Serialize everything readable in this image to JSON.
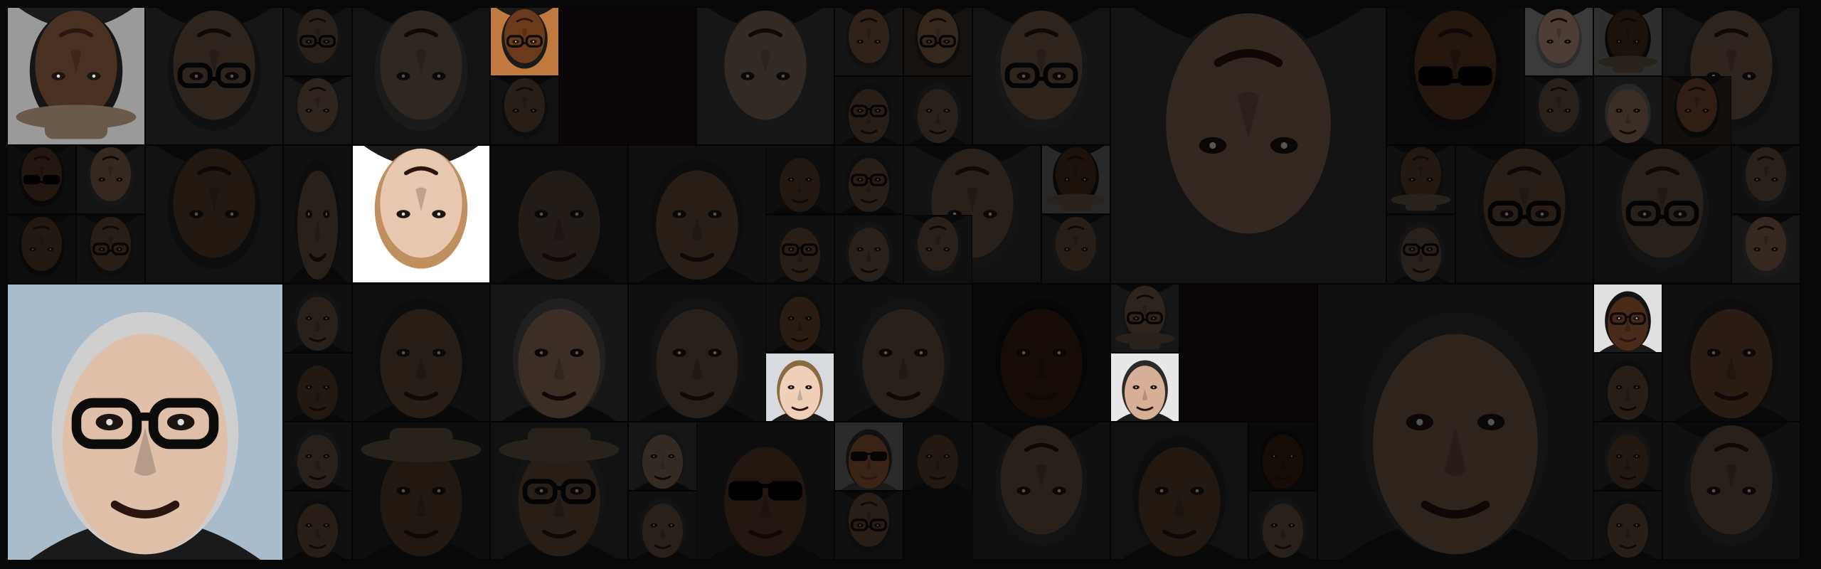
{
  "page": {
    "background": "#080808"
  },
  "mosaic": {
    "tiles": [
      {
        "kind": "photo",
        "state": "bright",
        "skin": "#4a3020",
        "bg": "#9a9a9a",
        "hair": "#151515",
        "glasses": false,
        "shades": false,
        "flip": true,
        "hat": true
      },
      {
        "kind": "photo",
        "state": "dim",
        "skin": "#7a6050",
        "bg": "#3a3a3a",
        "hair": "#2a2a2a",
        "glasses": true,
        "shades": false,
        "flip": true,
        "hat": false
      },
      {
        "kind": "photo",
        "state": "dim",
        "skin": "#6a5848",
        "bg": "#303030",
        "hair": "#333333",
        "glasses": true,
        "shades": false,
        "flip": true,
        "hat": false
      },
      {
        "kind": "photo",
        "state": "dim",
        "skin": "#7a6858",
        "bg": "#333333",
        "hair": "#444444",
        "glasses": false,
        "shades": false,
        "flip": true,
        "hat": false
      },
      {
        "kind": "photo",
        "state": "bright",
        "skin": "#6a3a1a",
        "bg": "#c07a40",
        "hair": "#1a1a1a",
        "glasses": true,
        "shades": false,
        "flip": true,
        "hat": false
      },
      {
        "kind": "photo",
        "state": "dim",
        "skin": "#6a5040",
        "bg": "#2d2d2d",
        "hair": "#222222",
        "glasses": false,
        "shades": false,
        "flip": true,
        "hat": false
      },
      {
        "kind": "blank",
        "state": "dim",
        "bg": "#1c1214"
      },
      {
        "kind": "photo",
        "state": "dim",
        "skin": "#857060",
        "bg": "#3b3b3b",
        "hair": "#3a3a3a",
        "glasses": false,
        "shades": false,
        "flip": true,
        "hat": false
      },
      {
        "kind": "photo",
        "state": "dim",
        "skin": "#7a5a48",
        "bg": "#353535",
        "hair": "#2a2a2a",
        "glasses": false,
        "shades": false,
        "flip": true,
        "hat": false
      },
      {
        "kind": "photo",
        "state": "dim",
        "skin": "#8a6a50",
        "bg": "#3a3028",
        "hair": "#222222",
        "glasses": true,
        "shades": false,
        "flip": true,
        "hat": false
      },
      {
        "kind": "photo",
        "state": "dim",
        "skin": "#7a6050",
        "bg": "#333333",
        "hair": "#3a3a3a",
        "glasses": true,
        "shades": false,
        "flip": true,
        "hat": false
      },
      {
        "kind": "photo",
        "state": "dim",
        "skin": "#856a58",
        "bg": "#363636",
        "hair": "#333333",
        "glasses": false,
        "shades": false,
        "flip": true,
        "hat": false
      },
      {
        "kind": "photo",
        "state": "dim",
        "skin": "#5a3a28",
        "bg": "#1e1e1e",
        "hair": "#151515",
        "glasses": false,
        "shades": true,
        "flip": true,
        "hat": false
      },
      {
        "kind": "photo",
        "state": "dim",
        "skin": "#c8a090",
        "bg": "#9a9a9a",
        "hair": "#777777",
        "glasses": false,
        "shades": false,
        "flip": true,
        "hat": false
      },
      {
        "kind": "photo",
        "state": "dim",
        "skin": "#4a3020",
        "bg": "#7a7a7a",
        "hair": "#151515",
        "glasses": false,
        "shades": false,
        "flip": true,
        "hat": true
      },
      {
        "kind": "photo",
        "state": "dim",
        "skin": "#7a6050",
        "bg": "#333333",
        "hair": "#2a2a2a",
        "glasses": false,
        "shades": false,
        "flip": true,
        "hat": false
      },
      {
        "kind": "photo",
        "state": "dim",
        "skin": "#5a3a2a",
        "bg": "#262626",
        "hair": "#1a1a1a",
        "glasses": false,
        "shades": true,
        "flip": true,
        "hat": false
      },
      {
        "kind": "photo",
        "state": "dim",
        "skin": "#8a6a58",
        "bg": "#333333",
        "hair": "#3a3a3a",
        "glasses": false,
        "shades": false,
        "flip": true,
        "hat": false
      },
      {
        "kind": "photo",
        "state": "dim",
        "skin": "#5a4030",
        "bg": "#303030",
        "hair": "#222222",
        "glasses": false,
        "shades": false,
        "flip": true,
        "hat": false
      },
      {
        "kind": "photo",
        "state": "dim",
        "skin": "#7a6050",
        "bg": "#383838",
        "hair": "#333333",
        "glasses": false,
        "shades": false,
        "flip": true,
        "hat": false
      },
      {
        "kind": "photo",
        "state": "dim",
        "skin": "#6a5848",
        "bg": "#2a2a2a",
        "hair": "#222222",
        "glasses": false,
        "shades": false,
        "flip": false,
        "hat": false
      },
      {
        "kind": "photo",
        "state": "bright",
        "skin": "#e8c8b0",
        "bg": "#ffffff",
        "hair": "#c09060",
        "glasses": false,
        "shades": false,
        "flip": true,
        "hat": false
      },
      {
        "kind": "photo",
        "state": "dim",
        "skin": "#5a4a40",
        "bg": "#242424",
        "hair": "#222222",
        "glasses": false,
        "shades": false,
        "flip": false,
        "hat": false
      },
      {
        "kind": "photo",
        "state": "dim",
        "skin": "#6a5040",
        "bg": "#2a2a2a",
        "hair": "#222222",
        "glasses": false,
        "shades": false,
        "flip": false,
        "hat": false
      },
      {
        "kind": "photo",
        "state": "dim",
        "skin": "#5a4030",
        "bg": "#262626",
        "hair": "#222222",
        "glasses": false,
        "shades": false,
        "flip": false,
        "hat": false
      },
      {
        "kind": "photo",
        "state": "dim",
        "skin": "#6a5040",
        "bg": "#2a2a2a",
        "hair": "#222222",
        "glasses": true,
        "shades": false,
        "flip": false,
        "hat": false
      },
      {
        "kind": "photo",
        "state": "dim",
        "skin": "#6a5448",
        "bg": "#2a2a2a",
        "hair": "#333333",
        "glasses": false,
        "shades": false,
        "flip": false,
        "hat": false
      },
      {
        "kind": "photo",
        "state": "dim",
        "skin": "#6a5040",
        "bg": "#2a2a2a",
        "hair": "#2a2a2a",
        "glasses": true,
        "shades": false,
        "flip": false,
        "hat": false
      },
      {
        "kind": "photo",
        "state": "dim",
        "skin": "#6a5040",
        "bg": "#2a2a2a",
        "hair": "#222222",
        "glasses": true,
        "shades": false,
        "flip": false,
        "hat": false
      },
      {
        "kind": "photo",
        "state": "dim",
        "skin": "#6a5448",
        "bg": "#303030",
        "hair": "#333333",
        "glasses": false,
        "shades": false,
        "flip": true,
        "hat": false
      },
      {
        "kind": "photo",
        "state": "dim",
        "skin": "#4a3020",
        "bg": "#6a6a6a",
        "hair": "#151515",
        "glasses": false,
        "shades": false,
        "flip": true,
        "hat": true
      },
      {
        "kind": "photo",
        "state": "dim",
        "skin": "#6a5040",
        "bg": "#2e2e2e",
        "hair": "#333333",
        "glasses": false,
        "shades": false,
        "flip": true,
        "hat": false
      },
      {
        "kind": "photo",
        "state": "dim",
        "skin": "#5a4030",
        "bg": "#252525",
        "hair": "#1a1a1a",
        "glasses": false,
        "shades": false,
        "flip": true,
        "hat": false
      },
      {
        "kind": "photo",
        "state": "dim",
        "skin": "#6a5040",
        "bg": "#2a2a2a",
        "hair": "#222222",
        "glasses": true,
        "shades": false,
        "flip": true,
        "hat": false
      },
      {
        "kind": "photo",
        "state": "dim",
        "skin": "#5a4030",
        "bg": "#2a2a2a",
        "hair": "#222222",
        "glasses": false,
        "shades": false,
        "flip": true,
        "hat": true
      },
      {
        "kind": "photo",
        "state": "dim",
        "skin": "#6a5040",
        "bg": "#2a2a2a",
        "hair": "#222222",
        "glasses": true,
        "shades": false,
        "flip": true,
        "hat": false
      },
      {
        "kind": "photo",
        "state": "dim",
        "skin": "#9a7a68",
        "bg": "#3a3a3a",
        "hair": "#666666",
        "glasses": false,
        "shades": false,
        "flip": false,
        "hat": false
      },
      {
        "kind": "photo",
        "state": "dim",
        "skin": "#6a5448",
        "bg": "#2a2a2a",
        "hair": "#333333",
        "glasses": true,
        "shades": false,
        "flip": true,
        "hat": false
      },
      {
        "kind": "photo",
        "state": "dim",
        "skin": "#6a5448",
        "bg": "#2a2a2a",
        "hair": "#333333",
        "glasses": false,
        "shades": false,
        "flip": true,
        "hat": false
      },
      {
        "kind": "photo",
        "state": "dim",
        "skin": "#8a6a58",
        "bg": "#3a3a3a",
        "hair": "#444444",
        "glasses": false,
        "shades": false,
        "flip": true,
        "hat": false
      },
      {
        "kind": "photo",
        "state": "dim",
        "skin": "#6a5448",
        "bg": "#2a2a2a",
        "hair": "#333333",
        "glasses": true,
        "shades": false,
        "flip": false,
        "hat": false
      },
      {
        "kind": "photo",
        "state": "dim",
        "skin": "#6a5448",
        "bg": "#2a2a2a",
        "hair": "#333333",
        "glasses": false,
        "shades": false,
        "flip": true,
        "hat": false
      },
      {
        "kind": "photo",
        "state": "dim",
        "skin": "#7a5038",
        "bg": "#302820",
        "hair": "#1a1a1a",
        "glasses": false,
        "shades": false,
        "flip": true,
        "hat": false
      },
      {
        "kind": "photo",
        "state": "dim",
        "skin": "#6a5448",
        "bg": "#2a2a2a",
        "hair": "#333333",
        "glasses": false,
        "shades": false,
        "flip": true,
        "hat": false
      },
      {
        "kind": "photo",
        "state": "dim",
        "skin": "#6a5448",
        "bg": "#2a2a2a",
        "hair": "#333333",
        "glasses": false,
        "shades": false,
        "flip": false,
        "hat": false
      },
      {
        "kind": "photo",
        "state": "bright",
        "skin": "#e0c0a8",
        "bg": "#a8bccc",
        "hair": "#cfcfcf",
        "glasses": true,
        "shades": false,
        "flip": false,
        "hat": false
      },
      {
        "kind": "photo",
        "state": "dim",
        "skin": "#6a5448",
        "bg": "#2a2a2a",
        "hair": "#333333",
        "glasses": false,
        "shades": false,
        "flip": false,
        "hat": false
      },
      {
        "kind": "photo",
        "state": "dim",
        "skin": "#6a5040",
        "bg": "#2a2a2a",
        "hair": "#222222",
        "glasses": false,
        "shades": false,
        "flip": false,
        "hat": false
      },
      {
        "kind": "photo",
        "state": "dim",
        "skin": "#9a7a68",
        "bg": "#3a3a3a",
        "hair": "#555555",
        "glasses": false,
        "shades": false,
        "flip": false,
        "hat": false
      },
      {
        "kind": "photo",
        "state": "dim",
        "skin": "#6a5448",
        "bg": "#2a2a2a",
        "hair": "#333333",
        "glasses": false,
        "shades": false,
        "flip": false,
        "hat": false
      },
      {
        "kind": "photo",
        "state": "dim",
        "skin": "#6a4a38",
        "bg": "#2a2a2a",
        "hair": "#222222",
        "glasses": false,
        "shades": false,
        "flip": false,
        "hat": false
      },
      {
        "kind": "photo",
        "state": "bright",
        "skin": "#f0d0b8",
        "bg": "#d8dce0",
        "hair": "#8a6a40",
        "glasses": false,
        "shades": false,
        "flip": false,
        "hat": false
      },
      {
        "kind": "photo",
        "state": "dim",
        "skin": "#6a5448",
        "bg": "#2a2a2a",
        "hair": "#333333",
        "glasses": false,
        "shades": false,
        "flip": false,
        "hat": false
      },
      {
        "kind": "photo",
        "state": "dim",
        "skin": "#3a2418",
        "bg": "#1a1a1a",
        "hair": "#111111",
        "glasses": false,
        "shades": false,
        "flip": false,
        "hat": false
      },
      {
        "kind": "photo",
        "state": "dim",
        "skin": "#7a6050",
        "bg": "#3a3a3a",
        "hair": "#333333",
        "glasses": true,
        "shades": false,
        "flip": true,
        "hat": true
      },
      {
        "kind": "photo",
        "state": "bright",
        "skin": "#d8b098",
        "bg": "#e8e8e8",
        "hair": "#2a2a2a",
        "glasses": false,
        "shades": false,
        "flip": false,
        "hat": false
      },
      {
        "kind": "blank",
        "state": "dim",
        "bg": "#1c1214"
      },
      {
        "kind": "photo",
        "state": "dim",
        "skin": "#7a6050",
        "bg": "#2a2a2a",
        "hair": "#333333",
        "glasses": false,
        "shades": false,
        "flip": false,
        "hat": false
      },
      {
        "kind": "photo",
        "state": "bright",
        "skin": "#4a2a18",
        "bg": "#e0e0e0",
        "hair": "#111111",
        "glasses": true,
        "shades": false,
        "flip": false,
        "hat": false
      },
      {
        "kind": "photo",
        "state": "dim",
        "skin": "#6a4a38",
        "bg": "#2a2a2a",
        "hair": "#222222",
        "glasses": false,
        "shades": false,
        "flip": false,
        "hat": false
      },
      {
        "kind": "photo",
        "state": "dim",
        "skin": "#6a5040",
        "bg": "#2a2a2a",
        "hair": "#222222",
        "glasses": false,
        "shades": false,
        "flip": false,
        "hat": false
      },
      {
        "kind": "photo",
        "state": "dim",
        "skin": "#5a4030",
        "bg": "#262626",
        "hair": "#222222",
        "glasses": false,
        "shades": false,
        "flip": false,
        "hat": false
      },
      {
        "kind": "photo",
        "state": "dim",
        "skin": "#6a5448",
        "bg": "#2a2a2a",
        "hair": "#333333",
        "glasses": false,
        "shades": false,
        "flip": false,
        "hat": false
      },
      {
        "kind": "photo",
        "state": "dim",
        "skin": "#6a5040",
        "bg": "#2a2a2a",
        "hair": "#222222",
        "glasses": false,
        "shades": false,
        "flip": false,
        "hat": false
      },
      {
        "kind": "photo",
        "state": "dim",
        "skin": "#5a4030",
        "bg": "#262626",
        "hair": "#222222",
        "glasses": false,
        "shades": false,
        "flip": false,
        "hat": true
      },
      {
        "kind": "photo",
        "state": "dim",
        "skin": "#6a5040",
        "bg": "#2e2e2e",
        "hair": "#333333",
        "glasses": true,
        "shades": false,
        "flip": false,
        "hat": true
      },
      {
        "kind": "photo",
        "state": "dim",
        "skin": "#8a7060",
        "bg": "#3a3a3a",
        "hair": "#333333",
        "glasses": false,
        "shades": false,
        "flip": false,
        "hat": false
      },
      {
        "kind": "photo",
        "state": "dim",
        "skin": "#6a5448",
        "bg": "#2a2a2a",
        "hair": "#333333",
        "glasses": false,
        "shades": false,
        "flip": false,
        "hat": false
      },
      {
        "kind": "photo",
        "state": "dim",
        "skin": "#5a3a2a",
        "bg": "#262626",
        "hair": "#222222",
        "glasses": false,
        "shades": true,
        "flip": false,
        "hat": false
      },
      {
        "kind": "photo",
        "state": "bright",
        "skin": "#3a2214",
        "bg": "#2a2a2a",
        "hair": "#111111",
        "glasses": false,
        "shades": true,
        "flip": false,
        "hat": false
      },
      {
        "kind": "photo",
        "state": "dim",
        "skin": "#5a4030",
        "bg": "#262626",
        "hair": "#222222",
        "glasses": false,
        "shades": false,
        "flip": false,
        "hat": false
      },
      {
        "kind": "photo",
        "state": "dim",
        "skin": "#6a5040",
        "bg": "#2a2a2a",
        "hair": "#222222",
        "glasses": true,
        "shades": false,
        "flip": true,
        "hat": false
      },
      {
        "kind": "photo",
        "state": "dim",
        "skin": "#6a5448",
        "bg": "#2a2a2a",
        "hair": "#333333",
        "glasses": false,
        "shades": false,
        "flip": true,
        "hat": false
      },
      {
        "kind": "photo",
        "state": "dim",
        "skin": "#5a4030",
        "bg": "#2e2e2e",
        "hair": "#222222",
        "glasses": false,
        "shades": false,
        "flip": false,
        "hat": false
      },
      {
        "kind": "photo",
        "state": "dim",
        "skin": "#3a2418",
        "bg": "#1a1a1a",
        "hair": "#111111",
        "glasses": false,
        "shades": false,
        "flip": false,
        "hat": false
      },
      {
        "kind": "photo",
        "state": "dim",
        "skin": "#6a5448",
        "bg": "#2a2a2a",
        "hair": "#333333",
        "glasses": false,
        "shades": false,
        "flip": false,
        "hat": false
      },
      {
        "kind": "photo",
        "state": "dim",
        "skin": "#5a4030",
        "bg": "#2a2a2a",
        "hair": "#333333",
        "glasses": false,
        "shades": false,
        "flip": false,
        "hat": false
      },
      {
        "kind": "photo",
        "state": "dim",
        "skin": "#6a5448",
        "bg": "#2a2a2a",
        "hair": "#333333",
        "glasses": false,
        "shades": false,
        "flip": true,
        "hat": false
      },
      {
        "kind": "photo",
        "state": "dim",
        "skin": "#6a5040",
        "bg": "#2a2a2a",
        "hair": "#222222",
        "glasses": false,
        "shades": false,
        "flip": false,
        "hat": false
      },
      {
        "kind": "photo",
        "state": "dim",
        "skin": "#6a5448",
        "bg": "#2a2a2a",
        "hair": "#333333",
        "glasses": false,
        "shades": false,
        "flip": true,
        "hat": false
      }
    ]
  }
}
